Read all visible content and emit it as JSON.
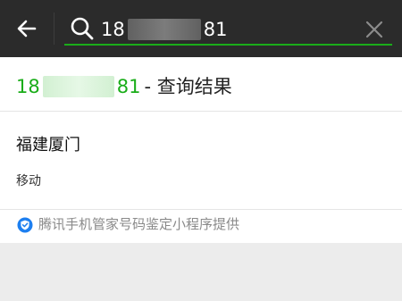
{
  "search": {
    "query_prefix": "18",
    "query_suffix": "81"
  },
  "result": {
    "number_prefix": "18",
    "number_suffix": "81",
    "title_suffix": "- 查询结果",
    "region": "福建厦门",
    "carrier": "移动"
  },
  "footer": {
    "provider_text": "腾讯手机管家号码鉴定小程序提供"
  },
  "icons": {
    "back": "arrow-left-icon",
    "search": "search-icon",
    "clear": "close-icon",
    "footer": "shield-check-icon"
  },
  "colors": {
    "topbar": "#2b2b2b",
    "accent_green": "#1aad19",
    "footer_icon": "#1d7ff0"
  }
}
